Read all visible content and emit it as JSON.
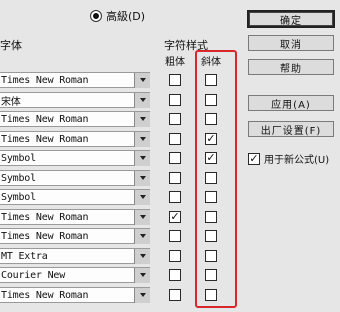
{
  "advanced_option": {
    "label": "高級(D)",
    "selected": true
  },
  "headers": {
    "font": "字体",
    "char_style": "字符样式",
    "bold": "粗体",
    "italic": "斜体"
  },
  "rows": [
    {
      "font": "Times New Roman",
      "bold": false,
      "italic": false
    },
    {
      "font": "宋体",
      "bold": false,
      "italic": false
    },
    {
      "font": "Times New Roman",
      "bold": false,
      "italic": false
    },
    {
      "font": "Times New Roman",
      "bold": false,
      "italic": true
    },
    {
      "font": "Symbol",
      "bold": false,
      "italic": true
    },
    {
      "font": "Symbol",
      "bold": false,
      "italic": false
    },
    {
      "font": "Symbol",
      "bold": false,
      "italic": false
    },
    {
      "font": "Times New Roman",
      "bold": true,
      "italic": false
    },
    {
      "font": "Times New Roman",
      "bold": false,
      "italic": false
    },
    {
      "font": "MT Extra",
      "bold": false,
      "italic": false
    },
    {
      "font": "Courier New",
      "bold": false,
      "italic": false
    },
    {
      "font": "Times New Roman",
      "bold": false,
      "italic": false
    }
  ],
  "buttons": {
    "ok": "确定",
    "cancel": "取消",
    "help": "帮助",
    "apply": "应用(A)",
    "factory": "出厂设置(F)"
  },
  "use_for_new": {
    "label": "用于新公式(U)",
    "checked": true
  },
  "colors": {
    "annotation": "#d9272e"
  }
}
